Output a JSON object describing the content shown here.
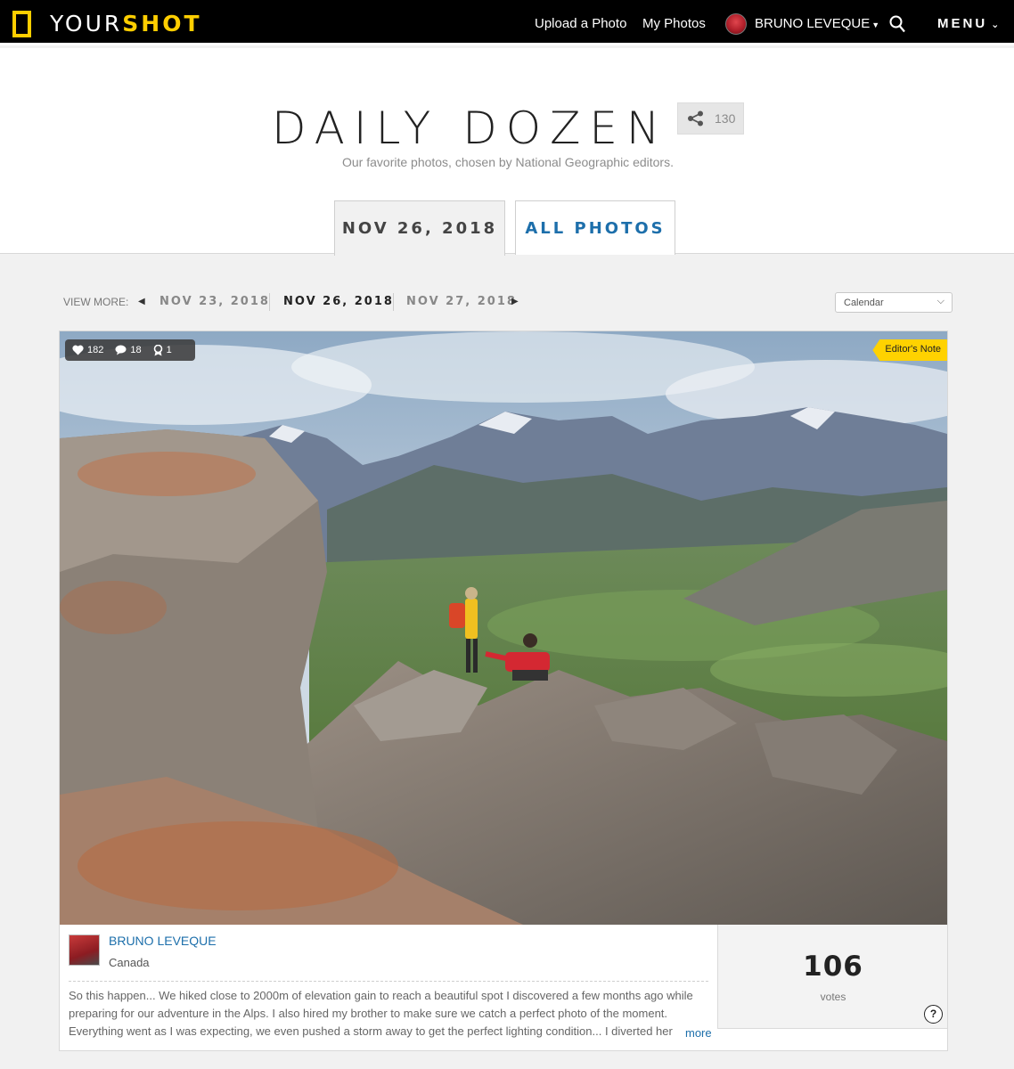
{
  "nav": {
    "logo_part1": "YOUR",
    "logo_part2": "SHOT",
    "upload": "Upload a Photo",
    "my_photos": "My Photos",
    "user": "BRUNO LEVEQUE",
    "menu": "MENU"
  },
  "header": {
    "title": "DAILY DOZEN",
    "subtitle": "Our favorite photos, chosen by National Geographic editors.",
    "share_count": "130"
  },
  "tabs": {
    "date": "NOV 26, 2018",
    "all": "ALL PHOTOS"
  },
  "view_more": {
    "label": "VIEW MORE:",
    "prev": "NOV 23, 2018",
    "current": "NOV 26, 2018",
    "next": "NOV 27, 2018",
    "calendar": "Calendar"
  },
  "photo": {
    "likes": "182",
    "comments": "18",
    "awards": "1",
    "badge": "Editor's Note"
  },
  "author": {
    "name": "BRUNO LEVEQUE",
    "location": "Canada",
    "caption": "So this happen... We hiked close to 2000m of elevation gain to reach a beautiful spot I discovered a few months ago while preparing for our adventure in the Alps. I also hired my brother to make sure we catch a perfect photo of the moment. Everything went as I was expecting, we even pushed a storm away to get the perfect lighting condition... I diverted her",
    "more": "more"
  },
  "votes": {
    "count": "106",
    "label": "votes",
    "help": "?"
  },
  "colors": {
    "brand_yellow": "#ffce00",
    "link_blue": "#1d6fab",
    "topbar": "#000000",
    "editor_note": "#ffd200"
  },
  "icons": [
    "logo-frame-icon",
    "search-icon",
    "chevron-down-icon",
    "share-icon",
    "heart-icon",
    "comment-icon",
    "award-icon",
    "help-icon"
  ]
}
